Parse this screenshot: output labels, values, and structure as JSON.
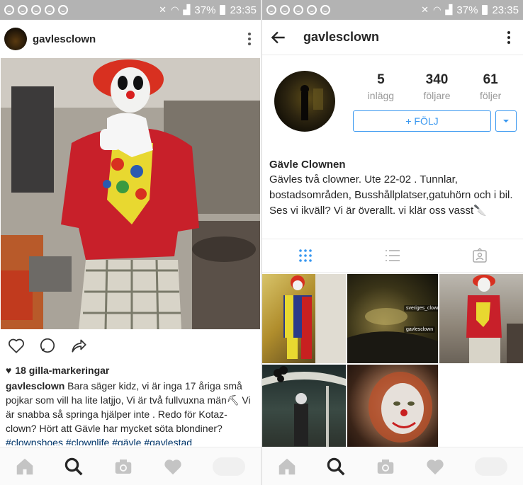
{
  "status_bar": {
    "battery": "37%",
    "time": "23:35"
  },
  "left_screen": {
    "username": "gavlesclown",
    "likes": "18 gilla-markeringar",
    "caption_user": "gavlesclown",
    "caption_text": "Bara säger kidz, vi är inga 17 åriga små pojkar som vill ha lite latjjo, Vi är två fullvuxna män⛏ Vi är snabba så springa hjälper inte . Redo för Kotaz-clown? Hört att Gävle har mycket söta blondiner?",
    "hashtags": "#clownshoes #clownlife #gävle #gavlestad"
  },
  "right_screen": {
    "username": "gavlesclown",
    "stats": [
      {
        "value": "5",
        "label": "inlägg"
      },
      {
        "value": "340",
        "label": "följare"
      },
      {
        "value": "61",
        "label": "följer"
      }
    ],
    "follow_label": "+ FÖLJ",
    "bio_name": "Gävle Clownen",
    "bio_text": "Gävles två clowner. Ute 22-02 . Tunnlar, bostadsområden, Busshållplatser,gatuhörn och i bil. Ses vi ikväll? Vi är överallt. vi klär oss vasst🔪",
    "grid_labels": {
      "thumb2_a": "sveriges_clowner",
      "thumb2_b": "gavlesclown"
    }
  },
  "colors": {
    "accent": "#3897f0",
    "statusbar": "#b3b3b3",
    "hashtag": "#003569"
  },
  "icons": [
    "heart-icon",
    "comment-icon",
    "share-icon",
    "home-icon",
    "search-icon",
    "camera-icon",
    "activity-heart-icon",
    "back-arrow-icon",
    "grid-view-icon",
    "list-view-icon",
    "tagged-icon",
    "chevron-down-icon"
  ]
}
